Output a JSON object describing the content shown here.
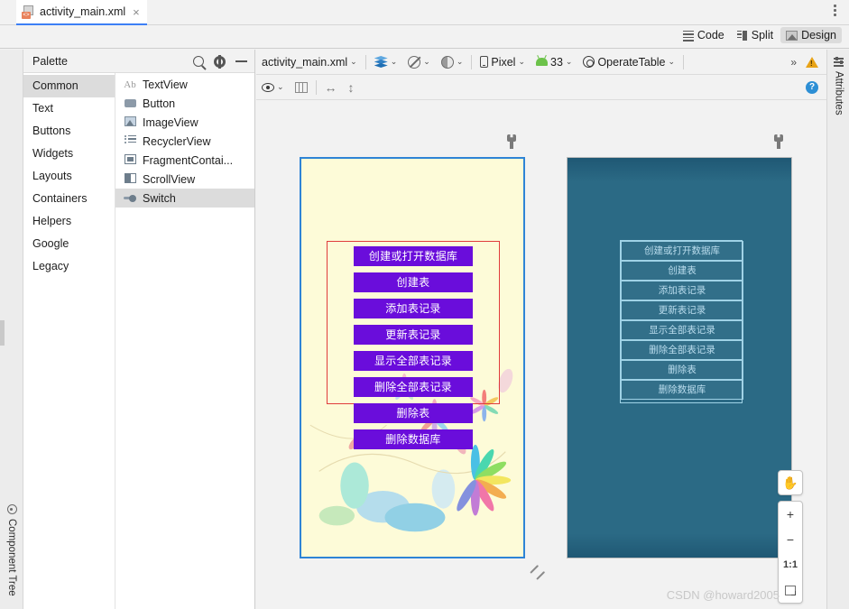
{
  "window": {
    "tab": {
      "name": "activity_main.xml",
      "close_label": "×",
      "icon": "xml-file-icon",
      "badge": "<>"
    },
    "kebab_name": "more-options-icon"
  },
  "mode_bar": {
    "modes": [
      {
        "label": "Code",
        "icon": "code-icon",
        "active": false
      },
      {
        "label": "Split",
        "icon": "split-icon",
        "active": false
      },
      {
        "label": "Design",
        "icon": "design-icon",
        "active": true
      }
    ]
  },
  "left_strip": {
    "palette_label": "Palette",
    "component_tree_label": "Component Tree"
  },
  "right_strip": {
    "attributes_label": "Attributes"
  },
  "palette": {
    "title": "Palette",
    "tools": [
      {
        "name": "search-icon",
        "label": ""
      },
      {
        "name": "gear-icon",
        "label": ""
      },
      {
        "name": "minimize-icon",
        "label": ""
      }
    ],
    "categories": [
      {
        "label": "Common",
        "selected": true
      },
      {
        "label": "Text",
        "selected": false
      },
      {
        "label": "Buttons",
        "selected": false
      },
      {
        "label": "Widgets",
        "selected": false
      },
      {
        "label": "Layouts",
        "selected": false
      },
      {
        "label": "Containers",
        "selected": false
      },
      {
        "label": "Helpers",
        "selected": false
      },
      {
        "label": "Google",
        "selected": false
      },
      {
        "label": "Legacy",
        "selected": false
      }
    ],
    "items": [
      {
        "label": "TextView",
        "icon": "textview-icon",
        "selected": false
      },
      {
        "label": "Button",
        "icon": "button-icon",
        "selected": false
      },
      {
        "label": "ImageView",
        "icon": "imageview-icon",
        "selected": false
      },
      {
        "label": "RecyclerView",
        "icon": "recyclerview-icon",
        "selected": false
      },
      {
        "label": "FragmentContai...",
        "icon": "fragment-container-icon",
        "selected": false
      },
      {
        "label": "ScrollView",
        "icon": "scrollview-icon",
        "selected": false
      },
      {
        "label": "Switch",
        "icon": "switch-icon",
        "selected": true
      }
    ]
  },
  "editor_toolbar": {
    "file_label": "activity_main.xml",
    "caret": "⌄",
    "design_mode_icon": "layers-icon",
    "orientation_icon": "no-blueprint-icon",
    "theme_contrast_icon": "night-mode-icon",
    "device_label": "Pixel",
    "api_label": "33",
    "theme_label": "OperateTable",
    "overflow_label": "»",
    "warning_icon": "warning-icon"
  },
  "view_toolbar": {
    "visibility_icon": "eye-icon",
    "columns_icon": "columns-icon",
    "h_resize_icon": "horizontal-arrow-icon",
    "v_resize_icon": "vertical-arrow-icon",
    "help_label": "?"
  },
  "canvas": {
    "wrench_icon": "wrench-icon",
    "buttons": [
      "创建或打开数据库",
      "创建表",
      "添加表记录",
      "更新表记录",
      "显示全部表记录",
      "删除全部表记录",
      "删除表",
      "删除数据库"
    ],
    "colors": {
      "button_bg": "#6a0ddb",
      "button_text": "#ffffff",
      "screen_bg": "#fdfbd8",
      "selection_border": "#2e84d6",
      "layout_outline": "#e03c3c",
      "blueprint_bg": "#2b6a85",
      "blueprint_stroke": "#9fd2e6"
    },
    "zoom_controls": {
      "pan_label": "✋",
      "zoom_in_label": "+",
      "zoom_out_label": "−",
      "actual_size_label": "1:1",
      "zoom_to_fit_label": ""
    },
    "watermark": "CSDN @howard2005"
  }
}
